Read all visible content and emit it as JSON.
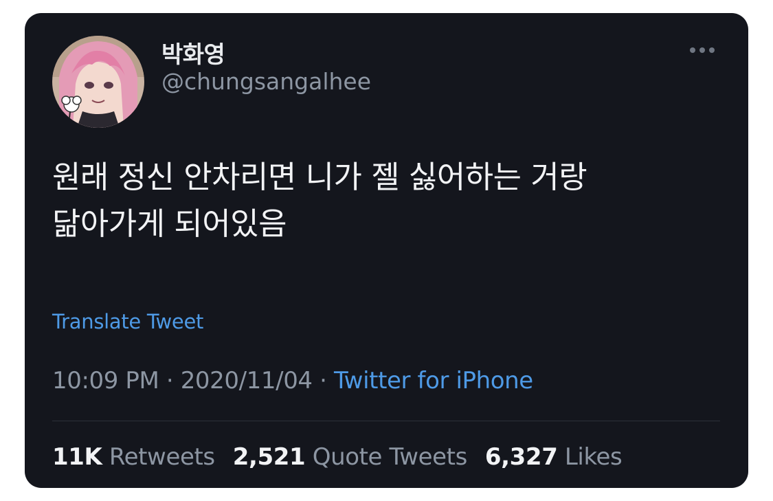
{
  "tweet": {
    "display_name": "박화영",
    "handle": "@chungsangalhee",
    "more_icon": "more-horizontal-icon",
    "avatar": "user-avatar-anime-pink-hair",
    "text": "원래 정신 안차리면 니가 젤 싫어하는 거랑\n닮아가게 되어있음",
    "translate_label": "Translate Tweet",
    "time": "10:09 PM",
    "separator": "·",
    "date": "2020/11/04",
    "source": "Twitter for iPhone",
    "stats": {
      "retweets_count": "11K",
      "retweets_label": "Retweets",
      "quotes_count": "2,521",
      "quotes_label": "Quote Tweets",
      "likes_count": "6,327",
      "likes_label": "Likes"
    }
  },
  "colors": {
    "card_background": "#14161d",
    "page_background": "#ffffff",
    "primary_text": "#f2f3f5",
    "secondary_text": "#8d96a3",
    "link": "#4e9ae6",
    "divider": "#2c313a"
  }
}
